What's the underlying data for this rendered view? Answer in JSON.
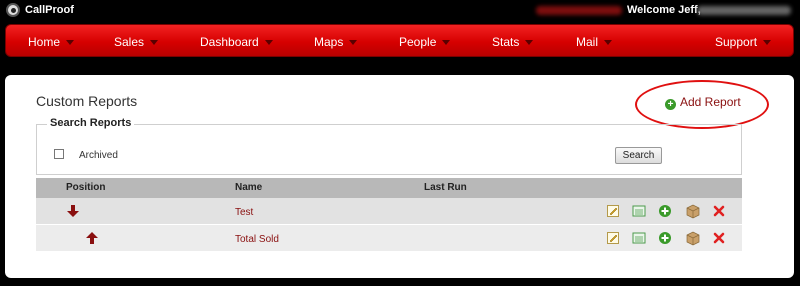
{
  "topbar": {
    "brand": "CallProof",
    "welcome": "Welcome Jeff,"
  },
  "nav": {
    "items": [
      {
        "label": "Home"
      },
      {
        "label": "Sales"
      },
      {
        "label": "Dashboard"
      },
      {
        "label": "Maps"
      },
      {
        "label": "People"
      },
      {
        "label": "Stats"
      },
      {
        "label": "Mail"
      },
      {
        "label": "Support"
      }
    ]
  },
  "page": {
    "title": "Custom Reports",
    "add_report": "Add Report"
  },
  "search": {
    "legend": "Search Reports",
    "archived_label": "Archived",
    "button": "Search"
  },
  "table": {
    "columns": [
      "Position",
      "Name",
      "Last Run"
    ],
    "rows": [
      {
        "name": "Test",
        "last_run": "",
        "position_icon": "arrow-down-icon"
      },
      {
        "name": "Total Sold",
        "last_run": "",
        "position_icon": "arrow-up-icon"
      }
    ],
    "action_icons": [
      "edit-icon",
      "csv-icon",
      "add-icon",
      "archive-box-icon",
      "delete-icon"
    ]
  },
  "colors": {
    "nav_red": "#d60000",
    "link_red": "#8a1010",
    "annotation_red": "#e01010",
    "add_green": "#3a9a2a"
  }
}
